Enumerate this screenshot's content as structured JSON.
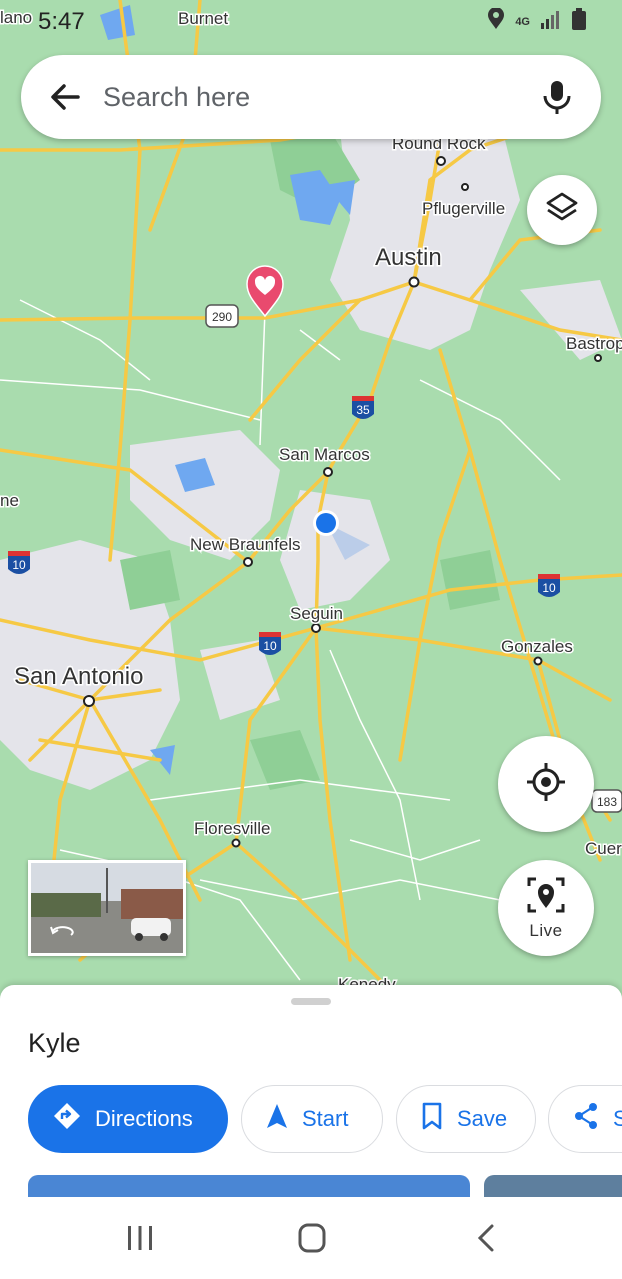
{
  "status_bar": {
    "time": "5:47",
    "network": "4G"
  },
  "search": {
    "placeholder": "Search here",
    "back_icon": "arrow-back-icon",
    "mic_icon": "mic-icon"
  },
  "map": {
    "labels": {
      "austin": "Austin",
      "round_rock": "Round Rock",
      "pflugerville": "Pflugerville",
      "bastrop": "Bastrop",
      "san_marcos": "San Marcos",
      "new_braunfels": "New Braunfels",
      "seguin": "Seguin",
      "gonzales": "Gonzales",
      "san_antonio": "San Antonio",
      "floresville": "Floresville",
      "kenedy": "Kenedy",
      "cuero": "Cuer",
      "llano": "lano",
      "burnet": "Burnet",
      "edge_text": "ne"
    },
    "shields": {
      "us290": "290",
      "i35": "35",
      "i10_west": "10",
      "i10_seguin": "10",
      "i10_east": "10",
      "us183": "183"
    },
    "colors": {
      "land": "#a9dcae",
      "urban": "#e8e8ee",
      "highway": "#f6c945",
      "road": "#ffffff",
      "water": "#6fa8f0",
      "pin": "#e94a6e",
      "location_dot": "#1a73e8"
    }
  },
  "controls": {
    "layers_icon": "layers-icon",
    "locate_icon": "my-location-icon",
    "live_label": "Live"
  },
  "sheet": {
    "place_name": "Kyle",
    "actions": {
      "directions": "Directions",
      "start": "Start",
      "save": "Save",
      "share": "S"
    }
  }
}
